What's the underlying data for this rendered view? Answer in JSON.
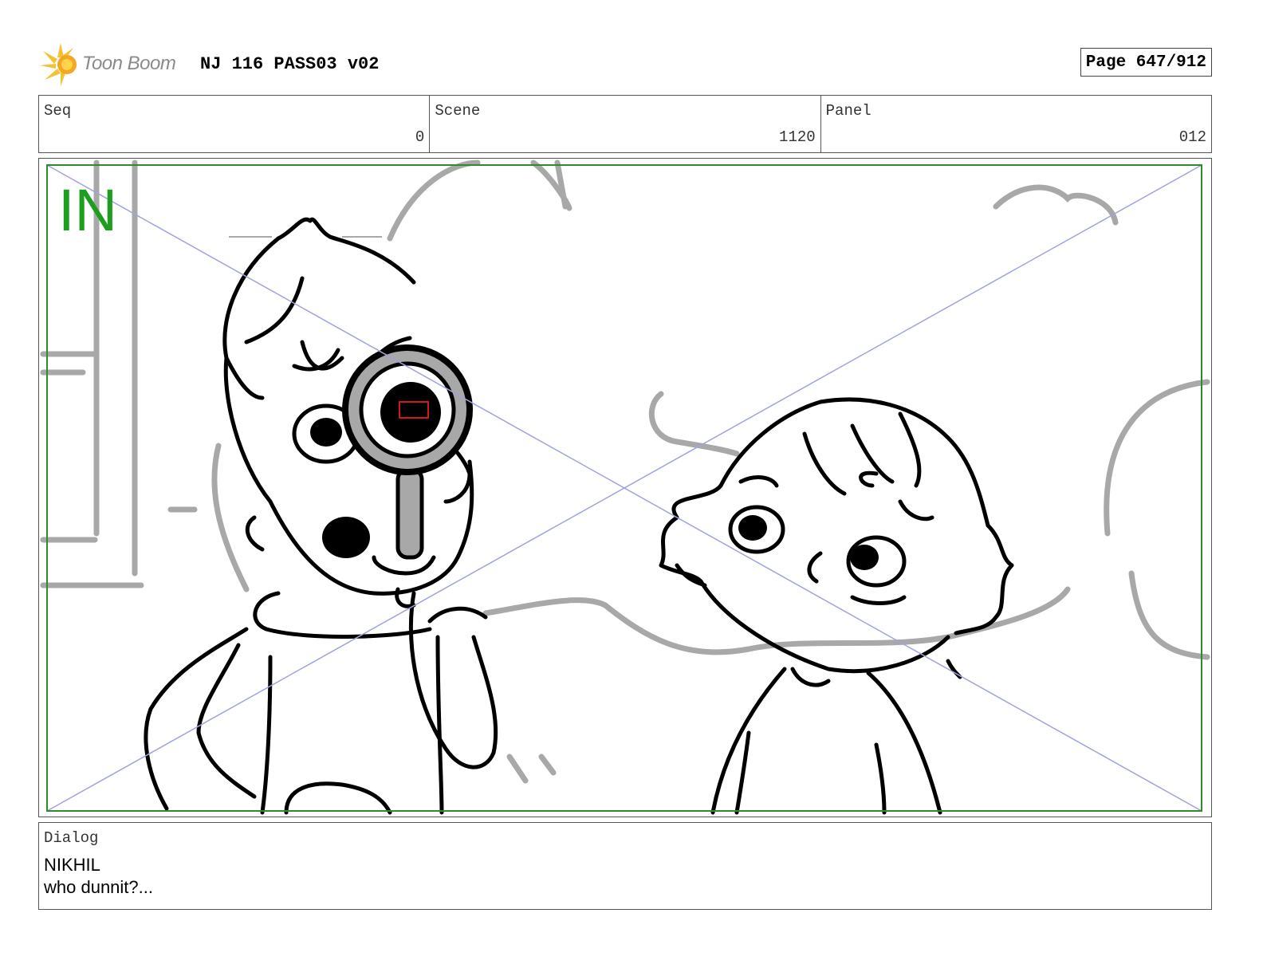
{
  "header": {
    "logo_text": "Toon Boom",
    "title": "NJ 116 PASS03 v02",
    "page_label": "Page 647/912"
  },
  "info": {
    "seq_label": "Seq",
    "seq_value": "0",
    "scene_label": "Scene",
    "scene_value": "1120",
    "panel_label": "Panel",
    "panel_value": "012"
  },
  "panel": {
    "marker_text": "IN",
    "marker_color": "#1e9e1e",
    "safe_frame_color": "#2e8b2e",
    "guide_color": "#9fa3e0",
    "sketch_color": "#000000",
    "background_color": "#a8a8a8"
  },
  "dialog": {
    "label": "Dialog",
    "character": "NIKHIL",
    "line": "who dunnit?..."
  }
}
